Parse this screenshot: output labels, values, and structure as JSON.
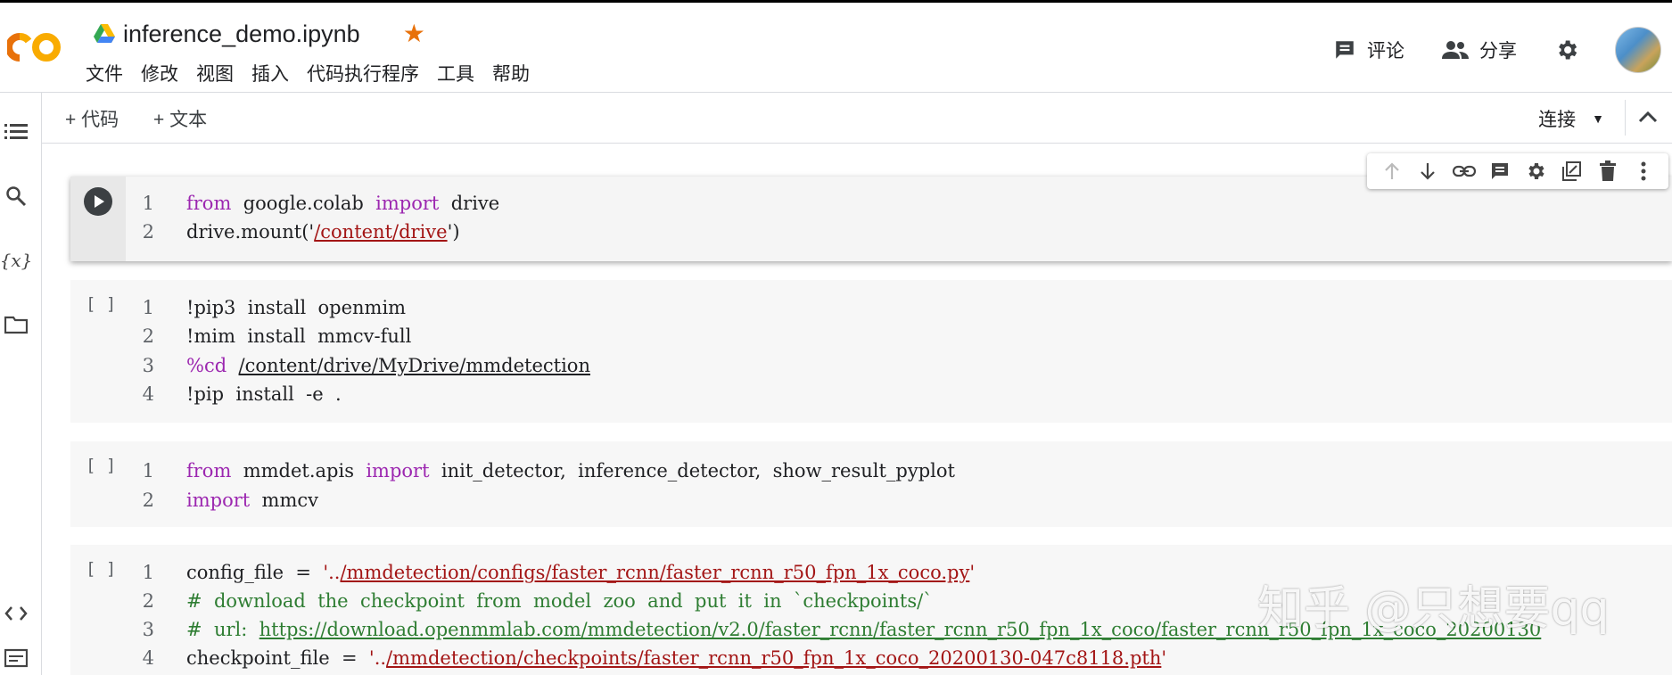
{
  "header": {
    "logo_text": "CO",
    "notebook_title": "inference_demo.ipynb",
    "menu": [
      "文件",
      "修改",
      "视图",
      "插入",
      "代码执行程序",
      "工具",
      "帮助"
    ],
    "comment_label": "评论",
    "share_label": "分享"
  },
  "toolbar": {
    "add_code_label": "+ 代码",
    "add_text_label": "+ 文本",
    "connect_label": "连接"
  },
  "cells": [
    {
      "lines": [
        {
          "n": "1",
          "parts": [
            [
              "kw",
              "from"
            ],
            [
              "",
              "  google.colab  "
            ],
            [
              "kw",
              "import"
            ],
            [
              "",
              "  drive"
            ]
          ]
        },
        {
          "n": "2",
          "parts": [
            [
              "",
              "drive.mount('"
            ],
            [
              "strl",
              "/content/drive"
            ],
            [
              "",
              "')"
            ]
          ]
        }
      ]
    },
    {
      "bracket": "[ ]",
      "lines": [
        {
          "n": "1",
          "parts": [
            [
              "",
              "!pip3  install  openmim"
            ]
          ]
        },
        {
          "n": "2",
          "parts": [
            [
              "",
              "!mim  install  mmcv-full"
            ]
          ]
        },
        {
          "n": "3",
          "parts": [
            [
              "kw",
              "%cd"
            ],
            [
              "",
              "  "
            ],
            [
              "ul",
              "/content/drive/MyDrive/mmdetection"
            ]
          ]
        },
        {
          "n": "4",
          "parts": [
            [
              "",
              "!pip  install  -e  ."
            ]
          ]
        }
      ]
    },
    {
      "bracket": "[ ]",
      "lines": [
        {
          "n": "1",
          "parts": [
            [
              "kw",
              "from"
            ],
            [
              "",
              "  mmdet.apis  "
            ],
            [
              "kw",
              "import"
            ],
            [
              "",
              "  init_detector,  inference_detector,  show_result_pyplot"
            ]
          ]
        },
        {
          "n": "2",
          "parts": [
            [
              "kw",
              "import"
            ],
            [
              "",
              "  mmcv"
            ]
          ]
        }
      ]
    },
    {
      "bracket": "[ ]",
      "lines": [
        {
          "n": "1",
          "parts": [
            [
              "",
              "config_file  =  "
            ],
            [
              "str",
              "'.."
            ],
            [
              "strl",
              "/mmdetection/configs/faster_rcnn/faster_rcnn_r50_fpn_1x_coco.py"
            ],
            [
              "str",
              "'"
            ]
          ]
        },
        {
          "n": "2",
          "parts": [
            [
              "cm",
              "#  download  the  checkpoint  from  model  zoo  and  put  it  in  `checkpoints/`"
            ]
          ]
        },
        {
          "n": "3",
          "parts": [
            [
              "cm",
              "#  url:  "
            ],
            [
              "cml",
              "https://download.openmmlab.com/mmdetection/v2.0/faster_rcnn/faster_rcnn_r50_fpn_1x_coco/faster_rcnn_r50_fpn_1x_coco_20200130"
            ]
          ]
        },
        {
          "n": "4",
          "parts": [
            [
              "",
              "checkpoint_file  =  "
            ],
            [
              "str",
              "'.."
            ],
            [
              "strl",
              "/mmdetection/checkpoints/faster_rcnn_r50_fpn_1x_coco_20200130-047c8118.pth"
            ],
            [
              "str",
              "'"
            ]
          ]
        }
      ]
    }
  ],
  "watermark": "知乎 @只想要qq",
  "icons": {
    "sidebar": [
      "toc-icon",
      "search-icon",
      "variables-icon",
      "folder-icon",
      "code-snippets-icon",
      "terminal-icon"
    ],
    "cell_toolbar": [
      "arrow-up-icon",
      "arrow-down-icon",
      "link-icon",
      "comment-icon",
      "gear-icon",
      "mirror-cell-icon",
      "delete-icon",
      "more-vert-icon"
    ]
  },
  "colors": {
    "accent_orange": "#f9ab00",
    "star": "#e8710a",
    "keyword": "#9c27b0",
    "string": "#a31515",
    "comment": "#2e7d32"
  }
}
